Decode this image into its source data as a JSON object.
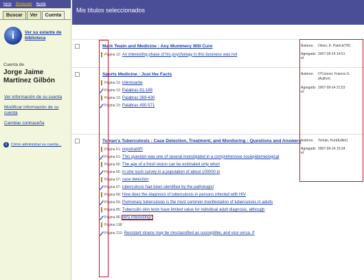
{
  "top_menu": [
    {
      "label": "Inicio",
      "active": false
    },
    {
      "label": "Destacado",
      "active": true
    },
    {
      "label": "Ayuda",
      "active": false
    }
  ],
  "tabs": [
    {
      "label": "Buscar",
      "active": false
    },
    {
      "label": "Ver",
      "active": false
    },
    {
      "label": "Cuenta",
      "active": true
    }
  ],
  "sidebar": {
    "shelf_link": "Ver su estante de biblioteca",
    "account_caption": "Cuenta de",
    "account_name": "Jorge Jaime Martínez Gilbón",
    "links": [
      "Ver información de su cuenta",
      "Modificar información de su cuenta",
      "Cambiar contraseña"
    ],
    "help_link": "Cómo administrar su cuenta..."
  },
  "main": {
    "header": "Mis títulos seleccionados"
  },
  "meta_labels": {
    "authors": "Autores:",
    "added": "Agregado el:"
  },
  "colors": {
    "header_bg": "#4a4e96",
    "sidebar_bg": "#f1f6dc",
    "link": "#1a3ba8",
    "highlight": "#c8101e"
  },
  "records": [
    {
      "title": "Mark Twain and Medicine : Any Mummery Will Cure",
      "authors": "Olsen, K. Patrick(TR)",
      "added": "2007-09-14 14:51",
      "notes": [
        {
          "page": "Página 12:",
          "text": "An interesting phase of his psychology in this business was not"
        }
      ]
    },
    {
      "title": "Sports Medicine : Just the Facts",
      "authors": "O'Connor, Francis G. (Author)",
      "added": "2007-09-14 21:53",
      "notes": [
        {
          "page": "Página 13:",
          "text": "interesante"
        },
        {
          "page": "Página 13:",
          "text": "Palabras 81-188"
        },
        {
          "page": "Página 13:",
          "text": "Palabras 389-430"
        },
        {
          "page": "Página 13:",
          "text": "Palabras 490-571"
        }
      ]
    },
    {
      "title": "Toman's Tuberculosis : Case Detection, Treatment, and Monitoring : Questions and Answers",
      "authors": "Toman, Kurt(Editor)",
      "added": "2007-09-14 15:34",
      "notes": [
        {
          "page": "Página 61:",
          "text": "importantf!!"
        },
        {
          "page": "Página 61:",
          "text": "This question was one of several investigated in a comprehensive sociepidemiological"
        },
        {
          "page": "Página 66:",
          "text": "The age of a fresh lesion can be estimated only when"
        },
        {
          "page": "Página 66:",
          "text": "In one such survey in a population of about 100000 in"
        },
        {
          "page": "Página 67:",
          "text": "case detection"
        },
        {
          "page": "Página 67:",
          "text": "tuberculosis had been identified by the pathologist"
        },
        {
          "page": "Página 69:",
          "text": "How does the diagnosis of tuberculosis in persons infected with HIV"
        },
        {
          "page": "Página 69:",
          "text": "Pulmonary tuberculosis is the most common manifestation of tuberculosis in adults"
        },
        {
          "page": "Página 85:",
          "text": "Tuberculin skin tests have limited value for individual adult diagnosis, although"
        },
        {
          "page": "Página 86:",
          "text": "very interesting!!"
        },
        {
          "page": "Página 138:",
          "text": ""
        },
        {
          "page": "Página 213:",
          "text": "Resistant strains may be misclassified as susceptible, and vice versa. If"
        }
      ]
    }
  ]
}
